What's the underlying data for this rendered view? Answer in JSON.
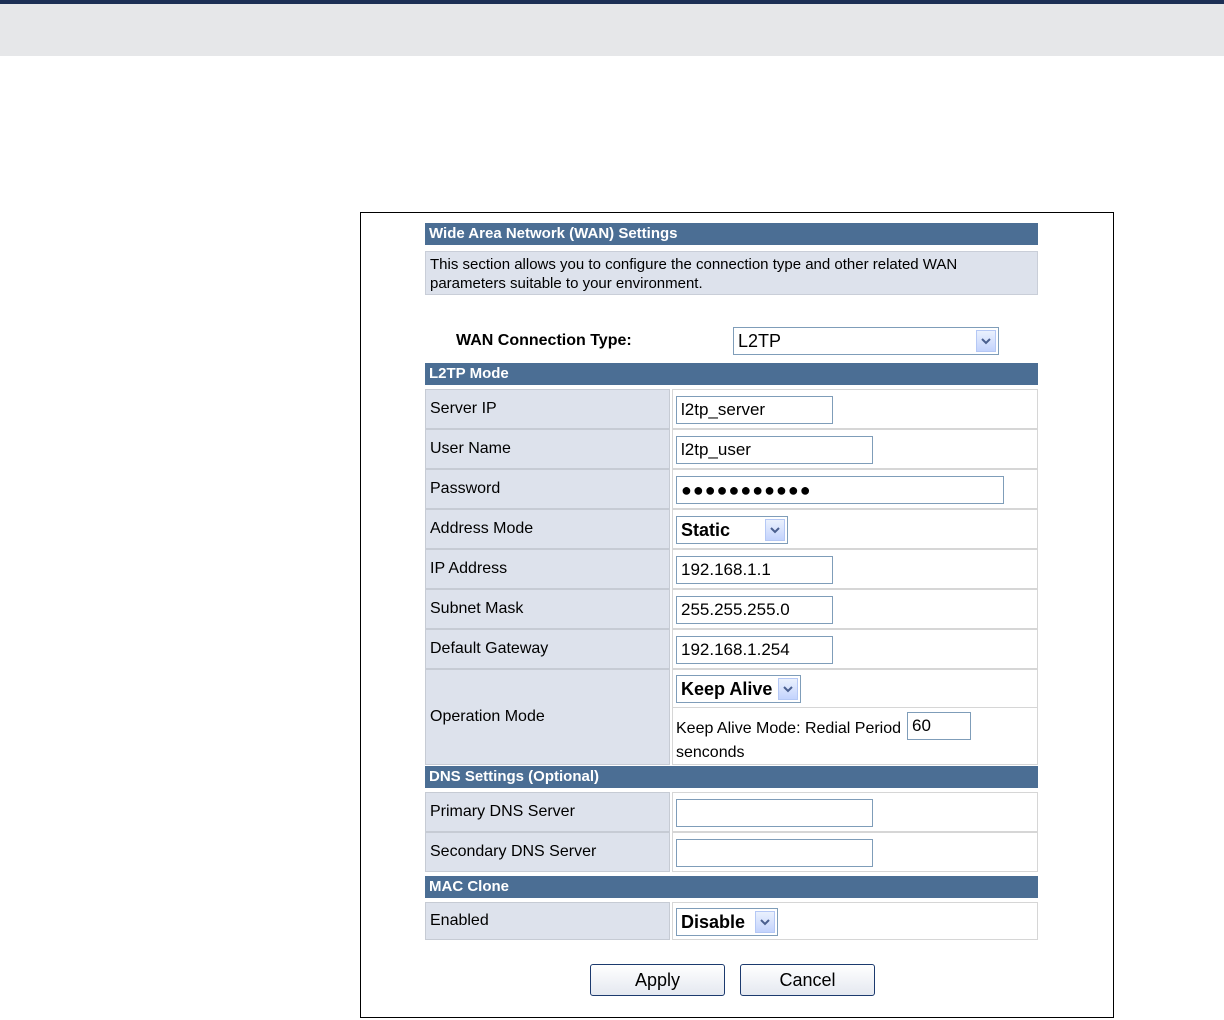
{
  "wan": {
    "header": "Wide Area Network (WAN) Settings",
    "description": "This section allows you to configure the connection type and other related WAN parameters suitable to your environment.",
    "connection_type_label": "WAN Connection Type:",
    "connection_type_value": "L2TP"
  },
  "l2tp": {
    "header": "L2TP Mode",
    "server_ip": {
      "label": "Server IP",
      "value": "l2tp_server"
    },
    "user_name": {
      "label": "User Name",
      "value": "l2tp_user"
    },
    "password": {
      "label": "Password",
      "value": "●●●●●●●●●●●"
    },
    "address_mode": {
      "label": "Address Mode",
      "value": "Static"
    },
    "ip_address": {
      "label": "IP Address",
      "value": "192.168.1.1"
    },
    "subnet_mask": {
      "label": "Subnet Mask",
      "value": "255.255.255.0"
    },
    "default_gateway": {
      "label": "Default Gateway",
      "value": "192.168.1.254"
    },
    "operation_mode": {
      "label": "Operation Mode",
      "value": "Keep Alive",
      "keep_alive_text": "Keep Alive Mode: Redial Period",
      "redial_period": "60",
      "unit": "senconds"
    }
  },
  "dns": {
    "header": "DNS Settings (Optional)",
    "primary": {
      "label": "Primary DNS Server",
      "value": ""
    },
    "secondary": {
      "label": "Secondary DNS Server",
      "value": ""
    }
  },
  "mac_clone": {
    "header": "MAC Clone",
    "enabled": {
      "label": "Enabled",
      "value": "Disable"
    }
  },
  "buttons": {
    "apply": "Apply",
    "cancel": "Cancel"
  }
}
